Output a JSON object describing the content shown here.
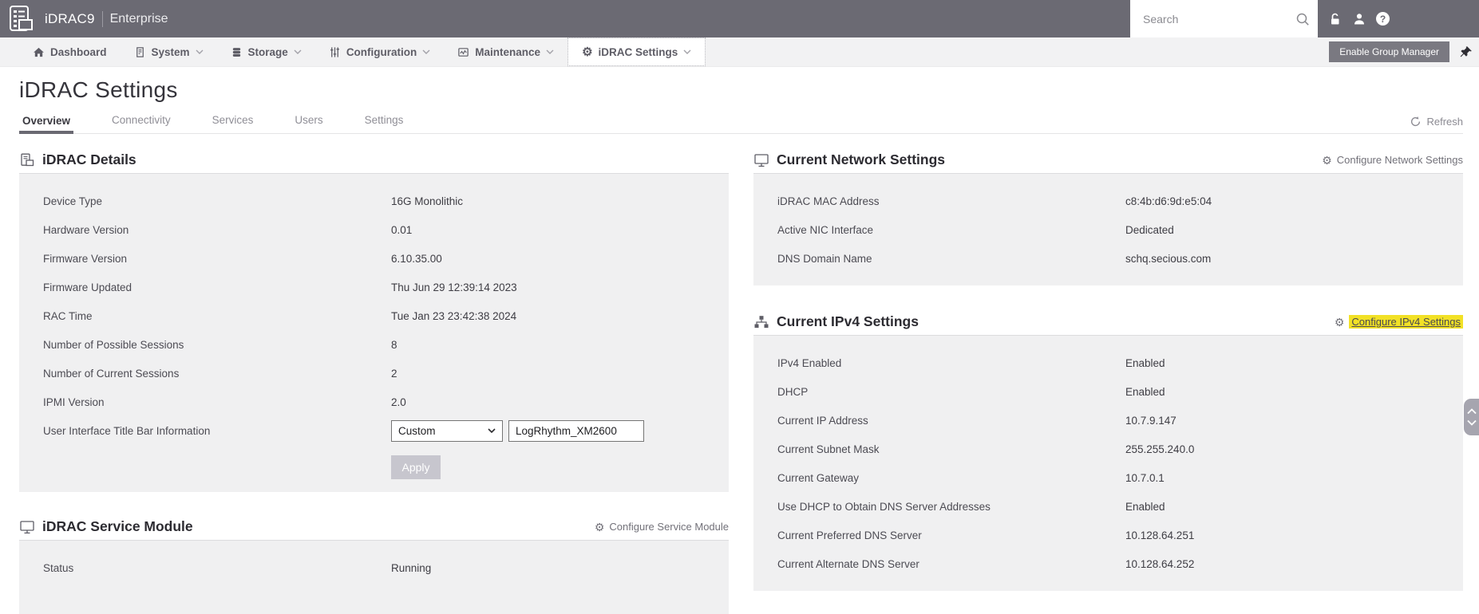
{
  "topbar": {
    "brand": "iDRAC9",
    "edition": "Enterprise",
    "search_placeholder": "Search"
  },
  "nav": {
    "items": [
      {
        "label": "Dashboard",
        "icon": "home-icon",
        "has_chevron": false
      },
      {
        "label": "System",
        "icon": "system-icon",
        "has_chevron": true
      },
      {
        "label": "Storage",
        "icon": "storage-icon",
        "has_chevron": true
      },
      {
        "label": "Configuration",
        "icon": "configuration-icon",
        "has_chevron": true
      },
      {
        "label": "Maintenance",
        "icon": "maintenance-icon",
        "has_chevron": true
      },
      {
        "label": "iDRAC Settings",
        "icon": "gear-icon",
        "has_chevron": true,
        "active": true
      }
    ],
    "enable_group_manager": "Enable Group Manager"
  },
  "page": {
    "title": "iDRAC Settings",
    "tabs": [
      {
        "label": "Overview",
        "active": true
      },
      {
        "label": "Connectivity",
        "active": false
      },
      {
        "label": "Services",
        "active": false
      },
      {
        "label": "Users",
        "active": false
      },
      {
        "label": "Settings",
        "active": false
      }
    ],
    "refresh": "Refresh"
  },
  "details": {
    "title": "iDRAC Details",
    "rows": [
      {
        "label": "Device Type",
        "value": "16G Monolithic"
      },
      {
        "label": "Hardware Version",
        "value": "0.01"
      },
      {
        "label": "Firmware Version",
        "value": "6.10.35.00"
      },
      {
        "label": "Firmware Updated",
        "value": "Thu Jun 29 12:39:14 2023"
      },
      {
        "label": "RAC Time",
        "value": "Tue Jan 23 23:42:38 2024"
      },
      {
        "label": "Number of Possible Sessions",
        "value": "8"
      },
      {
        "label": "Number of Current Sessions",
        "value": "2"
      },
      {
        "label": "IPMI Version",
        "value": "2.0"
      }
    ],
    "ui_row": {
      "label": "User Interface Title Bar Information",
      "select_value": "Custom",
      "input_value": "LogRhythm_XM2600"
    },
    "apply": "Apply"
  },
  "network": {
    "title": "Current Network Settings",
    "action": "Configure Network Settings",
    "rows": [
      {
        "label": "iDRAC MAC Address",
        "value": "c8:4b:d6:9d:e5:04"
      },
      {
        "label": "Active NIC Interface",
        "value": "Dedicated"
      },
      {
        "label": "DNS Domain Name",
        "value": "schq.secious.com"
      }
    ]
  },
  "ipv4": {
    "title": "Current IPv4 Settings",
    "action": "Configure IPv4 Settings",
    "action_highlighted": true,
    "rows": [
      {
        "label": "IPv4 Enabled",
        "value": "Enabled"
      },
      {
        "label": "DHCP",
        "value": "Enabled"
      },
      {
        "label": "Current IP Address",
        "value": "10.7.9.147"
      },
      {
        "label": "Current Subnet Mask",
        "value": "255.255.240.0"
      },
      {
        "label": "Current Gateway",
        "value": "10.7.0.1"
      },
      {
        "label": "Use DHCP to Obtain DNS Server Addresses",
        "value": "Enabled"
      },
      {
        "label": "Current Preferred DNS Server",
        "value": "10.128.64.251"
      },
      {
        "label": "Current Alternate DNS Server",
        "value": "10.128.64.252"
      }
    ]
  },
  "service_module": {
    "title": "iDRAC Service Module",
    "action": "Configure Service Module",
    "rows": [
      {
        "label": "Status",
        "value": "Running"
      }
    ]
  },
  "colors": {
    "topbar": "#6b6a73",
    "nav_bg": "#f2f2f3",
    "panel_body": "#f0f0f1",
    "active_tab_underline": "#6a6972",
    "highlight_yellow": "#f2e126",
    "button_gray": "#7a7981",
    "apply_disabled": "#c7c6ce"
  }
}
